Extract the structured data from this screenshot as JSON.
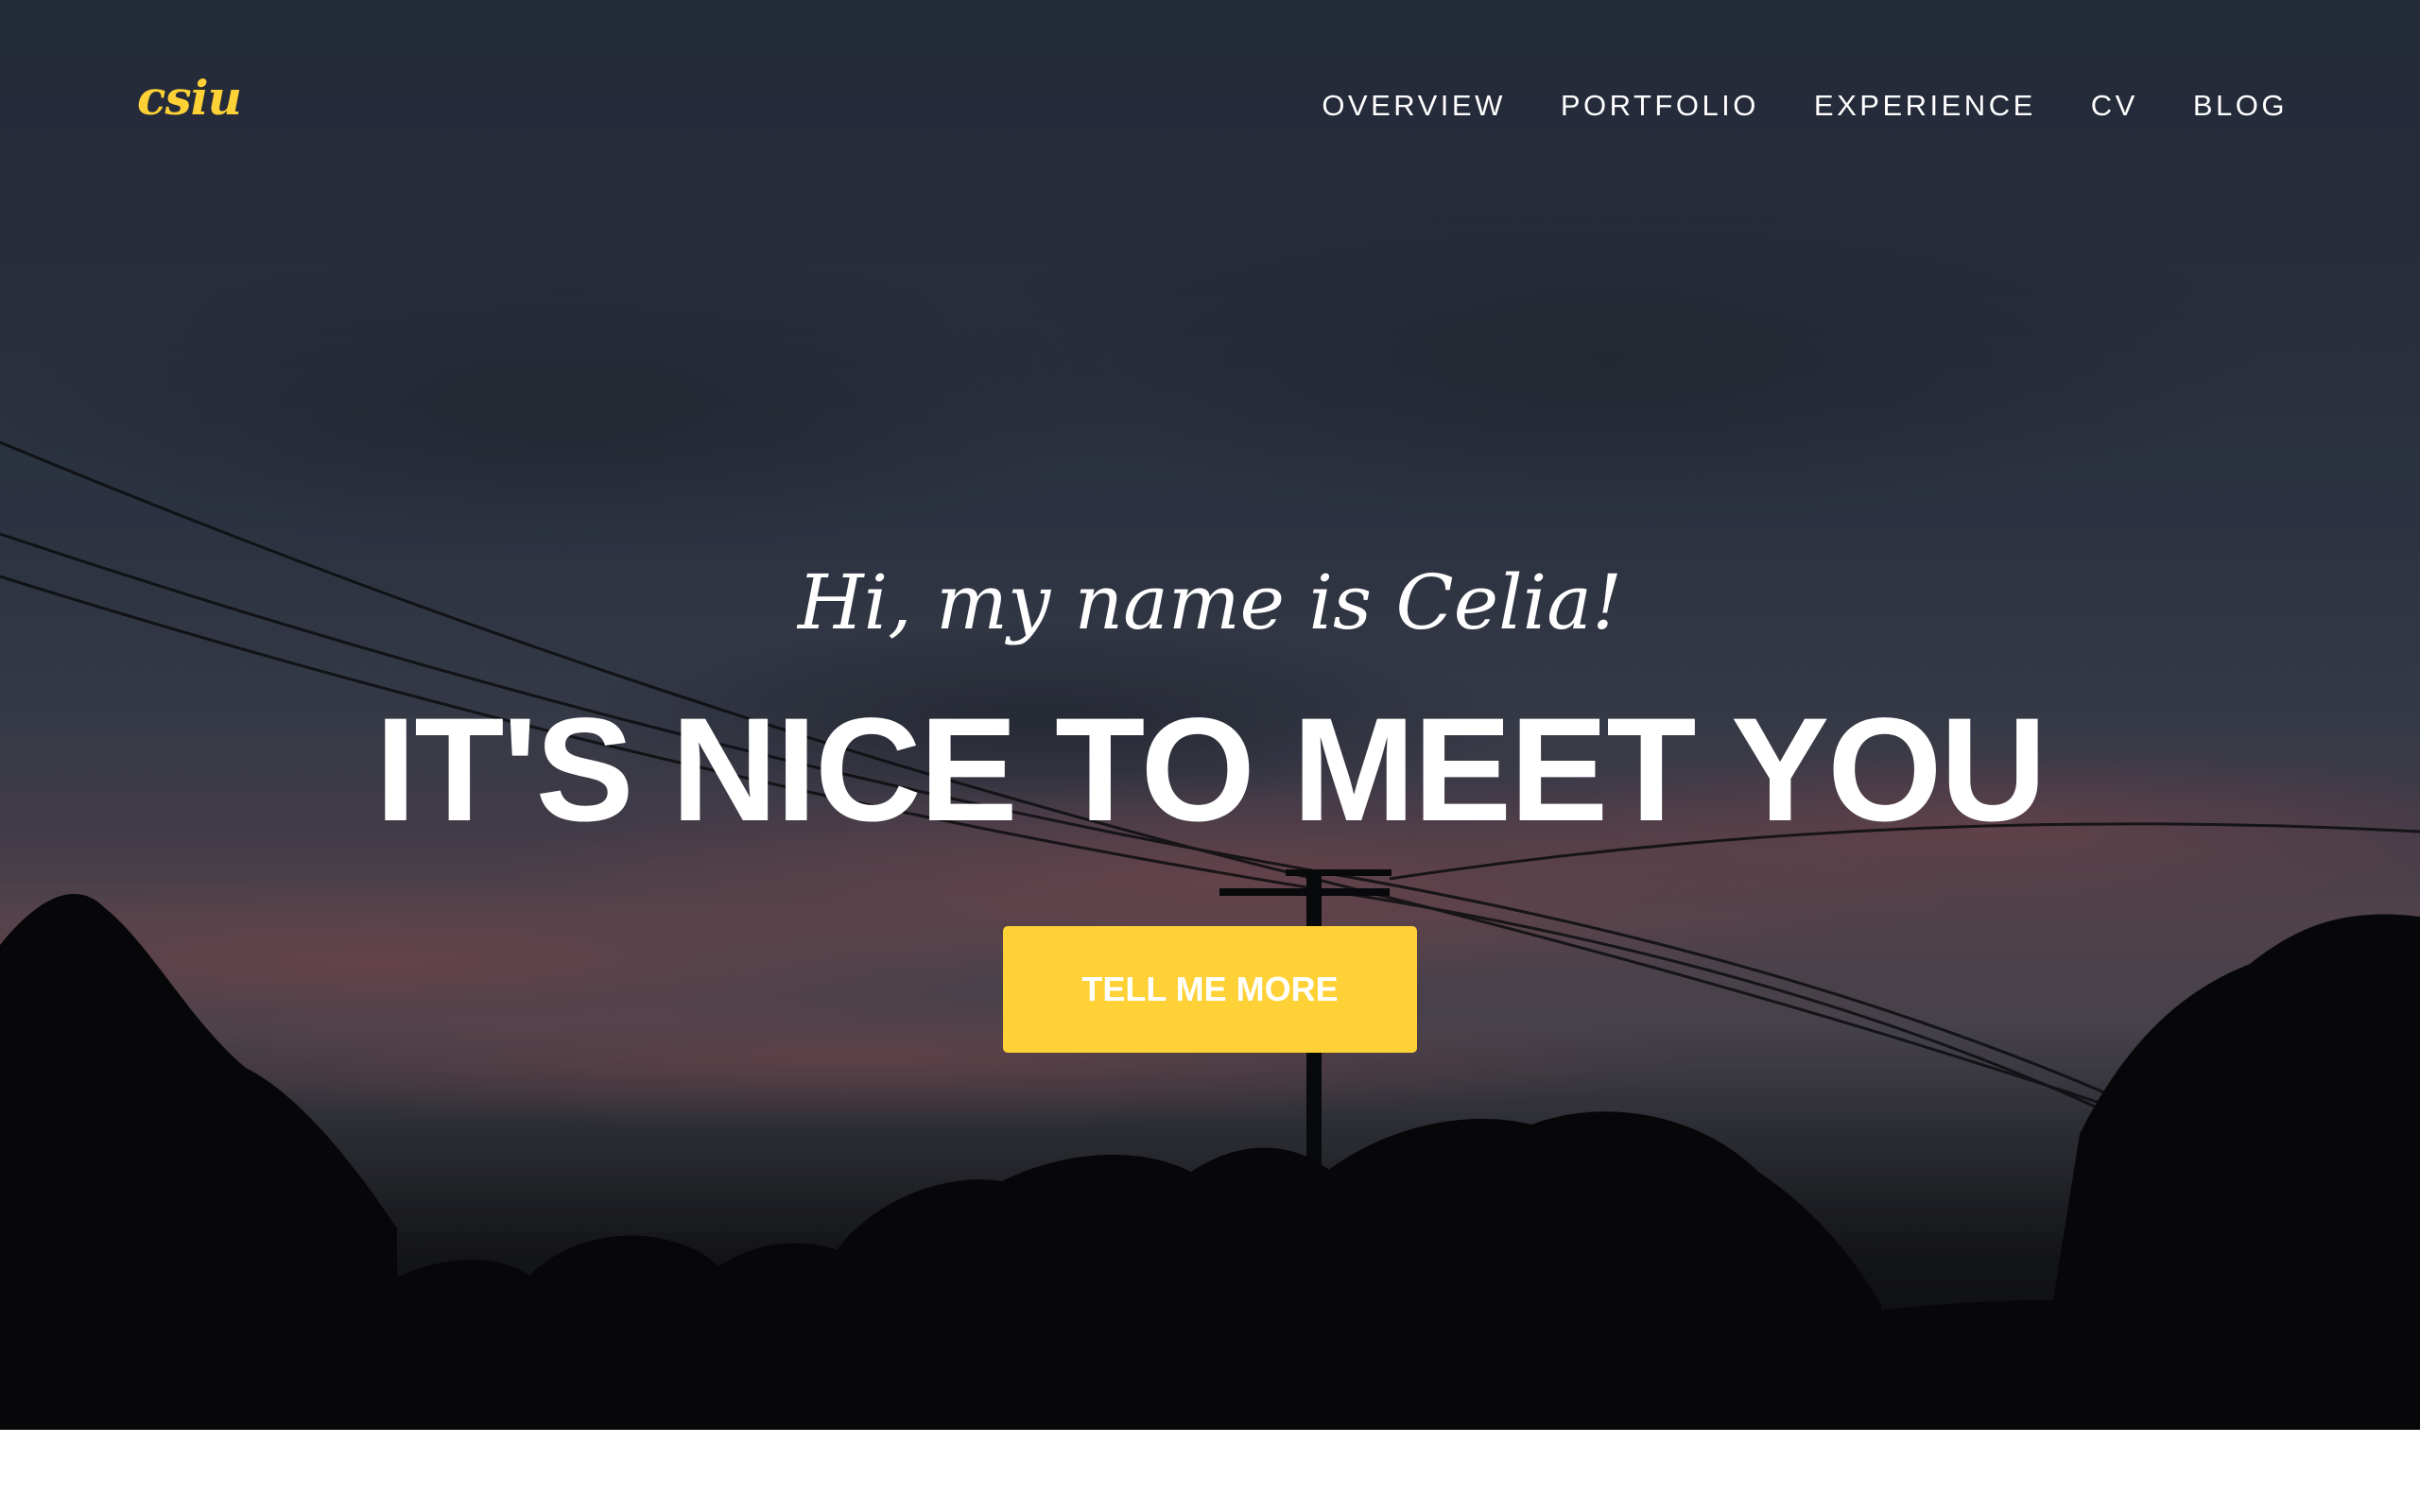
{
  "navbar": {
    "brand": "csiu",
    "links": [
      {
        "label": "OVERVIEW"
      },
      {
        "label": "PORTFOLIO"
      },
      {
        "label": "EXPERIENCE"
      },
      {
        "label": "CV"
      },
      {
        "label": "BLOG"
      }
    ]
  },
  "hero": {
    "lead_in": "Hi, my name is Celia!",
    "heading": "IT'S NICE TO MEET YOU",
    "cta_label": "TELL ME MORE"
  },
  "colors": {
    "accent": "#fed136",
    "text": "#ffffff",
    "below_fold": "#ffffff"
  }
}
